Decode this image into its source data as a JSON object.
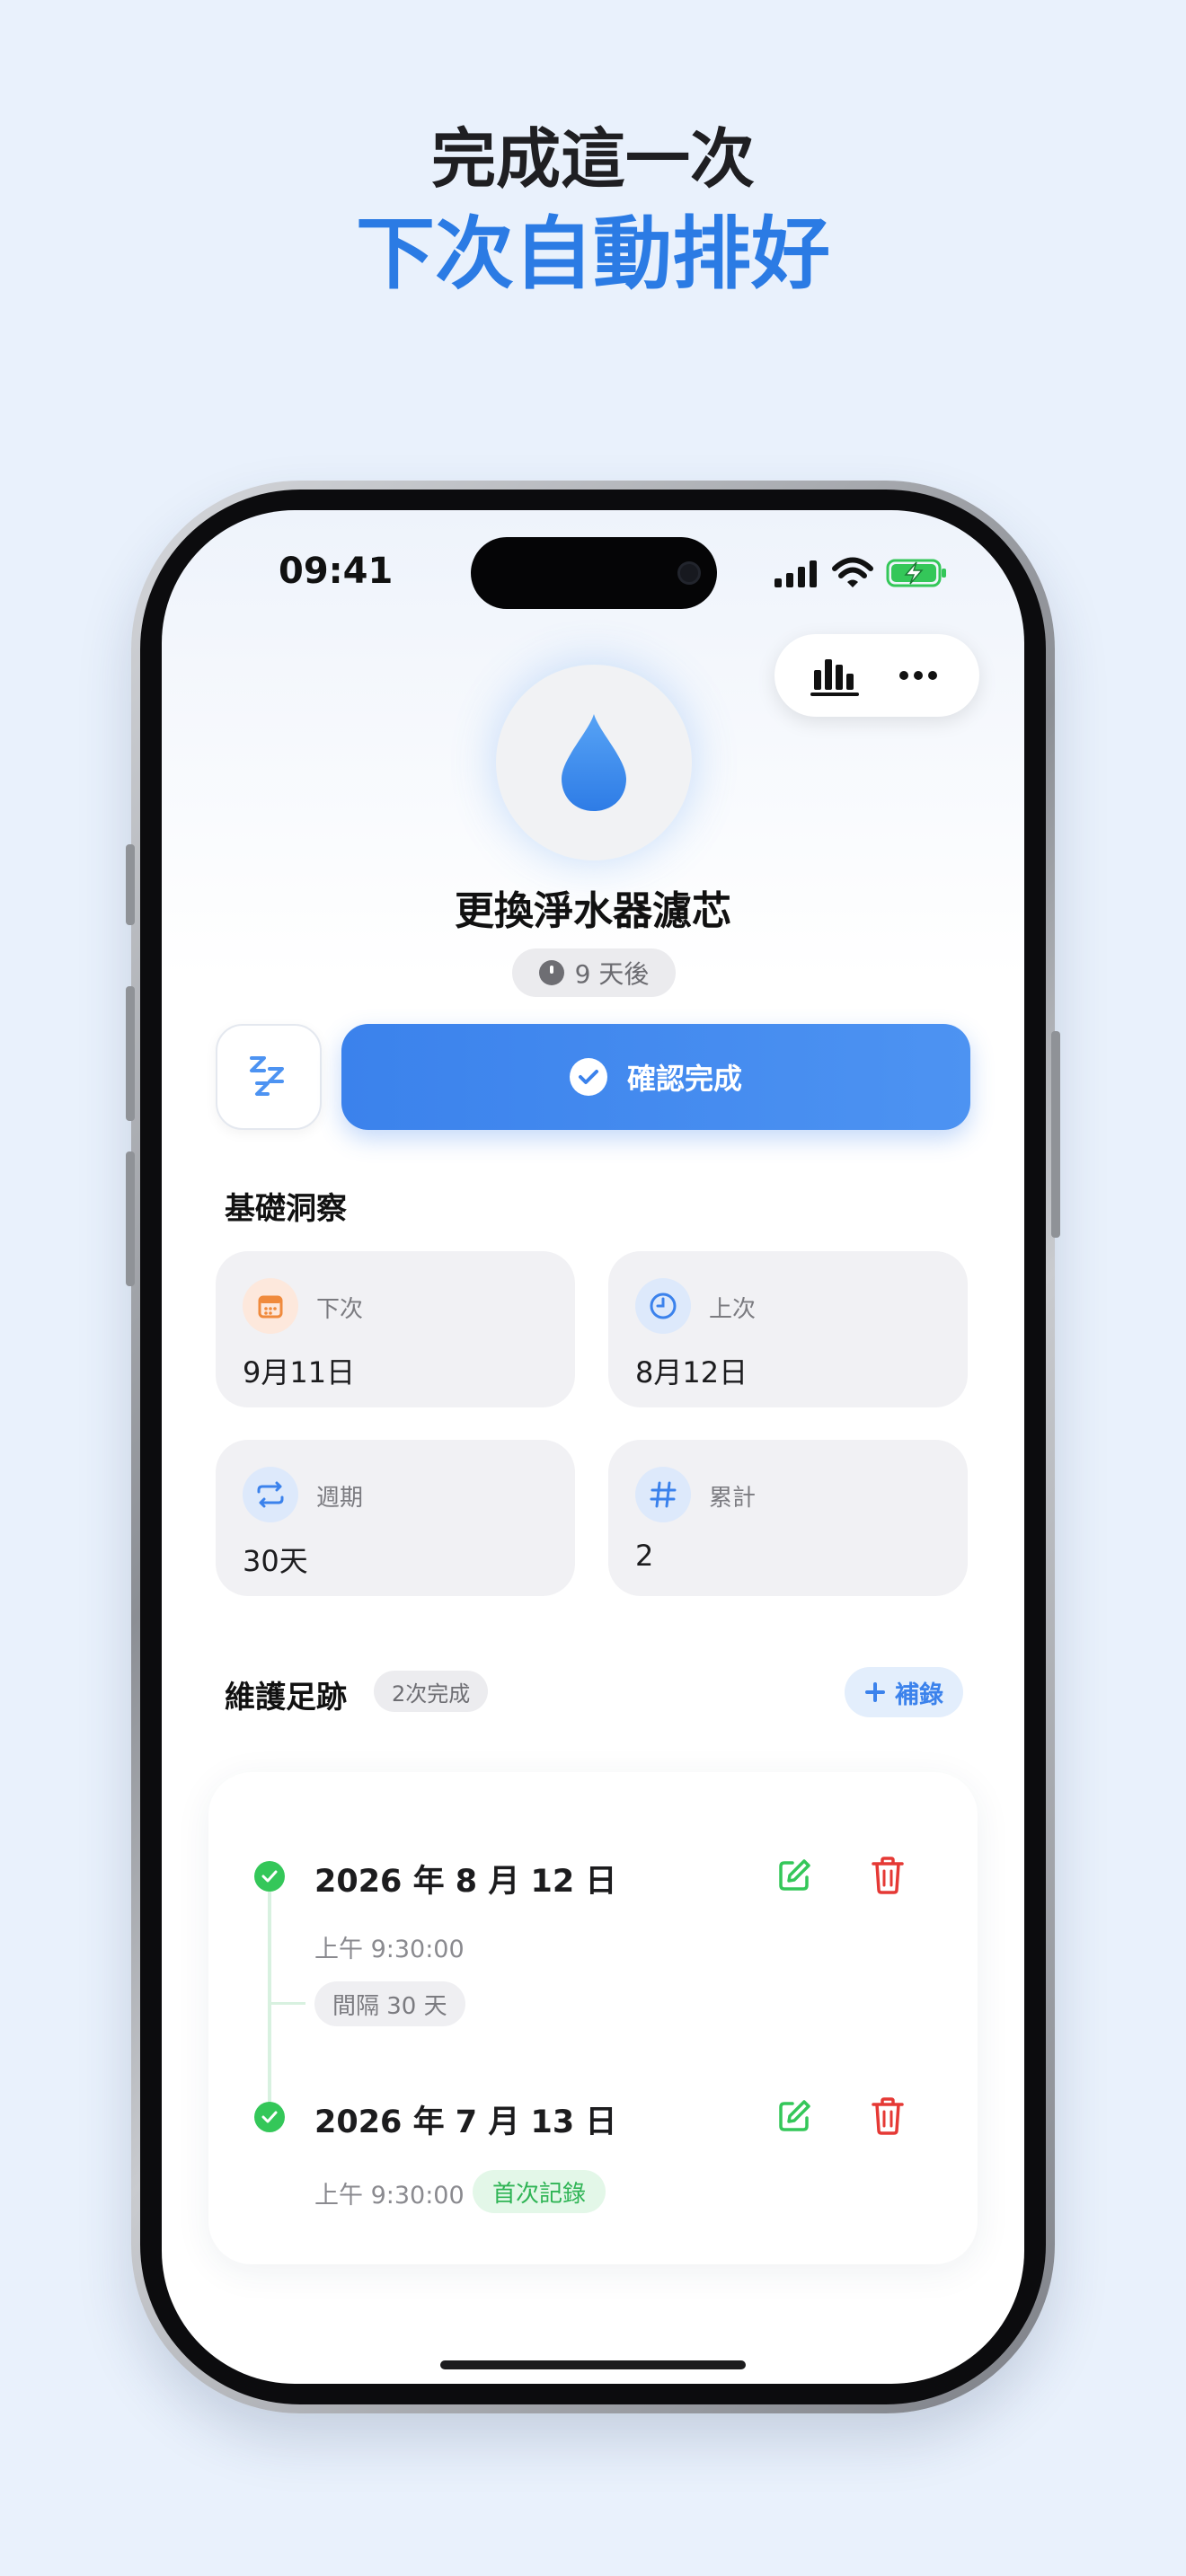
{
  "promo": {
    "line1": "完成這一次",
    "line2": "下次自動排好"
  },
  "status_bar": {
    "time": "09:41"
  },
  "toolbar": {
    "stats_icon": "bar-chart-icon",
    "more_icon": "ellipsis-icon"
  },
  "task": {
    "icon": "water-drop-icon",
    "title": "更換淨水器濾芯",
    "due": "9 天後"
  },
  "actions": {
    "snooze_icon": "zzz-icon",
    "confirm_label": "確認完成"
  },
  "insights": {
    "title": "基礎洞察",
    "cards": [
      {
        "icon": "calendar-icon",
        "label": "下次",
        "value": "9月11日"
      },
      {
        "icon": "clock-icon",
        "label": "上次",
        "value": "8月12日"
      },
      {
        "icon": "repeat-icon",
        "label": "週期",
        "value": "30天"
      },
      {
        "icon": "hash-icon",
        "label": "累計",
        "value": "2"
      }
    ]
  },
  "history": {
    "title": "維護足跡",
    "count_badge": "2次完成",
    "add_label": "補錄",
    "entries": [
      {
        "date": "2026 年 8 月 12 日",
        "time": "上午 9:30:00"
      },
      {
        "date": "2026 年 7 月 13 日",
        "time": "上午 9:30:00",
        "badge": "首次記錄"
      }
    ],
    "gap_label": "間隔 30 天"
  },
  "colors": {
    "accent": "#3b82ec",
    "success": "#34c759",
    "danger": "#e53935",
    "background": "#e9f1fc"
  }
}
